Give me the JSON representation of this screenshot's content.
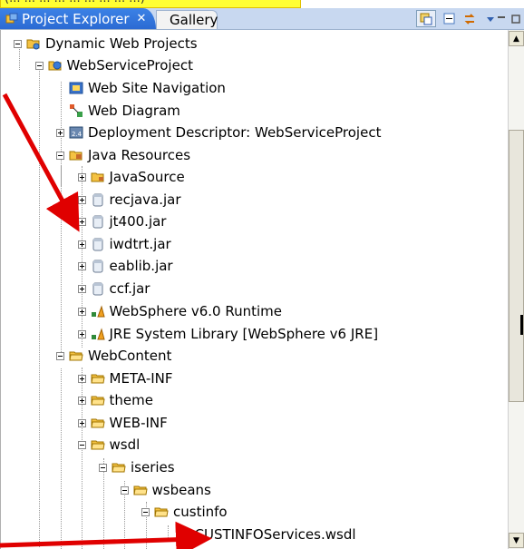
{
  "callout": {
    "text": "(... ... ... ... ... ... ... ... ...)"
  },
  "tabs": {
    "active": {
      "label": "Project Explorer",
      "close": "✕"
    },
    "inactive": {
      "label": "Gallery"
    }
  },
  "toolbar": {
    "buttons": [
      "link-with-editor-icon",
      "collapse-all-icon",
      "sync-icon",
      "view-menu-icon",
      "minimize-icon",
      "maximize-icon"
    ]
  },
  "tree": {
    "items": [
      {
        "label": "Dynamic Web Projects",
        "icon": "folder-group-icon",
        "expand": "minus"
      },
      {
        "label": "WebServiceProject",
        "icon": "web-project-icon",
        "expand": "minus"
      },
      {
        "label": "Web Site Navigation",
        "icon": "site-navigation-icon",
        "expand": "none"
      },
      {
        "label": "Web Diagram",
        "icon": "web-diagram-icon",
        "expand": "none"
      },
      {
        "label": "Deployment Descriptor: WebServiceProject",
        "icon": "deployment-descriptor-icon",
        "expand": "plus"
      },
      {
        "label": "Java Resources",
        "icon": "java-resources-icon",
        "expand": "minus"
      },
      {
        "label": "JavaSource",
        "icon": "source-folder-icon",
        "expand": "plus"
      },
      {
        "label": "recjava.jar",
        "icon": "jar-icon",
        "expand": "plus"
      },
      {
        "label": "jt400.jar",
        "icon": "jar-icon",
        "expand": "plus"
      },
      {
        "label": "iwdtrt.jar",
        "icon": "jar-icon",
        "expand": "plus"
      },
      {
        "label": "eablib.jar",
        "icon": "jar-icon",
        "expand": "plus"
      },
      {
        "label": "ccf.jar",
        "icon": "jar-icon",
        "expand": "plus"
      },
      {
        "label": "WebSphere v6.0 Runtime",
        "icon": "library-icon",
        "expand": "plus"
      },
      {
        "label": "JRE System Library [WebSphere v6 JRE]",
        "icon": "library-icon",
        "expand": "plus"
      },
      {
        "label": "WebContent",
        "icon": "folder-icon",
        "expand": "minus"
      },
      {
        "label": "META-INF",
        "icon": "folder-icon",
        "expand": "plus"
      },
      {
        "label": "theme",
        "icon": "folder-icon",
        "expand": "plus"
      },
      {
        "label": "WEB-INF",
        "icon": "folder-icon",
        "expand": "plus"
      },
      {
        "label": "wsdl",
        "icon": "folder-icon",
        "expand": "minus"
      },
      {
        "label": "iseries",
        "icon": "folder-icon",
        "expand": "minus"
      },
      {
        "label": "wsbeans",
        "icon": "folder-icon",
        "expand": "minus"
      },
      {
        "label": "custinfo",
        "icon": "folder-icon",
        "expand": "minus"
      },
      {
        "label": "CUSTINFOServices.wsdl",
        "icon": "wsdl-file-icon",
        "expand": "none"
      }
    ]
  },
  "colors": {
    "arrow": "#e00000",
    "tab_active": "#2f72dd",
    "callout": "#ffff33"
  }
}
